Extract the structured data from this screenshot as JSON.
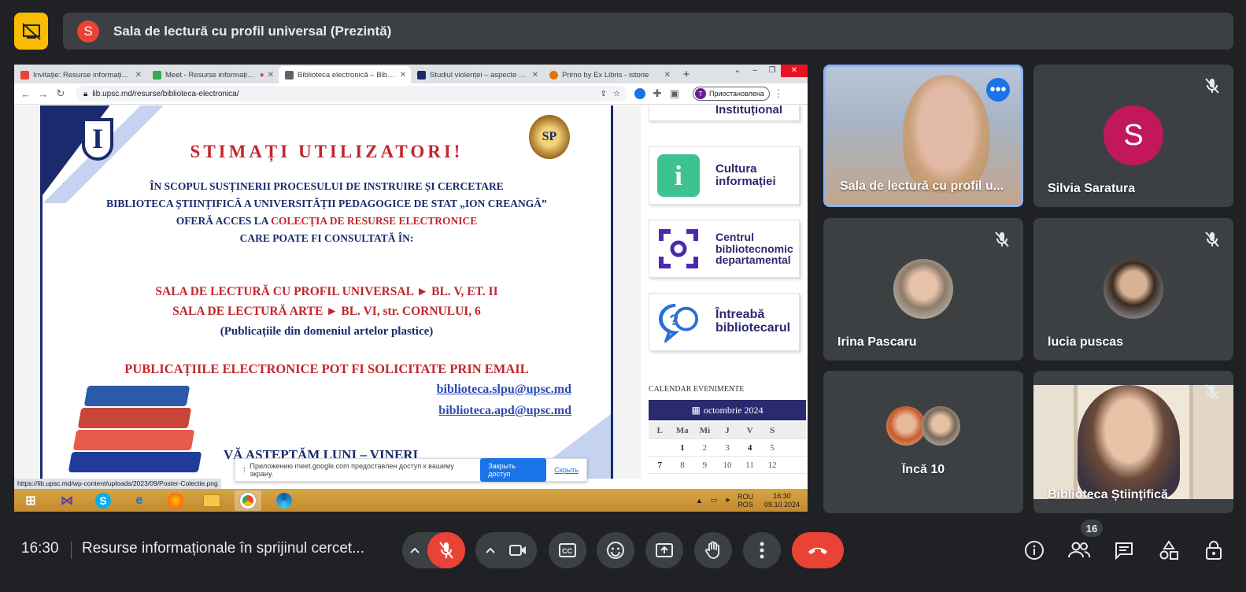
{
  "banner": {
    "presenter_initial": "S",
    "title": "Sala de lectură cu profil universal (Prezintă)"
  },
  "browser": {
    "tabs": [
      {
        "label": "Invitație: Resurse informaționale",
        "favicon_color": "#ea4335"
      },
      {
        "label": "Meet - Resurse informaționale",
        "favicon_color": "#34a853"
      },
      {
        "label": "Biblioteca electronică – Biblioteca",
        "favicon_color": "#5f6368"
      },
      {
        "label": "Studiul violenței – aspecte psihologice",
        "favicon_color": "#1a2a6c"
      },
      {
        "label": "Primo by Ex Libris - istorie",
        "favicon_color": "#e37400"
      }
    ],
    "url": "lib.upsc.md/resurse/biblioteca-electronica/",
    "profile_initial": "T",
    "profile_status": "Приостановлена",
    "status_url": "https://lib.upsc.md/wp-content/uploads/2023/09/Poster-Colectie.png"
  },
  "poster": {
    "logo_letter": "I",
    "seal_text": "SP",
    "title": "STIMAȚI UTILIZATORI!",
    "line1": "ÎN SCOPUL SUSȚINERII PROCESULUI DE INSTRUIRE ȘI CERCETARE",
    "line2": "BIBLIOTECA ȘTIINȚIFICĂ A UNIVERSITĂȚII PEDAGOGICE DE STAT „ION CREANGĂ”",
    "line3_a": "OFERĂ ACCES LA ",
    "line3_b": "COLECȚIA DE RESURSE ELECTRONICE",
    "line4": "CARE POATE FI CONSULTATĂ ÎN:",
    "loc1": "SALA DE LECTURĂ CU PROFIL UNIVERSAL ► BL. V, ET. II",
    "loc2": "SALA DE LECTURĂ ARTE ► BL. VI, str. CORNULUI, 6",
    "loc2_note": "(Publicațiile din domeniul artelor plastice)",
    "email_note": "PUBLICAȚIILE ELECTRONICE POT FI SOLICITATE PRIN EMAIL",
    "email1": "biblioteca.slpu@upsc.md",
    "email2": "biblioteca.apd@upsc.md",
    "bottom": "VĂ AȘTEPTĂM LUNI – VINERI"
  },
  "sidebar": {
    "top_card": "Instituțional",
    "cards": [
      {
        "line1": "Cultura",
        "line2": "informației"
      },
      {
        "line1": "Centrul",
        "line2": "bibliotecnomic",
        "line3": "departamental"
      },
      {
        "line1": "Întreabă",
        "line2": "bibliotecarul"
      }
    ],
    "calendar_title": "CALENDAR EVENIMENTE",
    "calendar_month": "octombrie 2024",
    "weekdays": [
      "L",
      "Ma",
      "Mi",
      "J",
      "V",
      "S"
    ],
    "days_row1": [
      "",
      "1",
      "2",
      "3",
      "4",
      "5"
    ],
    "days_row2": [
      "7",
      "8",
      "9",
      "10",
      "11",
      "12"
    ]
  },
  "share_bar": {
    "text": "Приложению meet.google.com предоставлен доступ к вашему экрану.",
    "stop_label": "Закрыть доступ",
    "hide_label": "Скрыть"
  },
  "taskbar": {
    "lang_top": "ROU",
    "lang_bottom": "ROS",
    "time": "16:30",
    "date": "09.10.2024"
  },
  "participants": [
    {
      "name": "Sala de lectură cu profil universal",
      "name_display": "Sala de lectură cu profil u..."
    },
    {
      "name": "Silvia Saratura",
      "initial": "S",
      "avatar_color": "#c2185b"
    },
    {
      "name": "Irina Pascaru"
    },
    {
      "name": "lucia puscas"
    },
    {
      "name": "Încă 10"
    },
    {
      "name": "Biblioteca Științifică"
    }
  ],
  "bottom_bar": {
    "time": "16:30",
    "meeting_title": "Resurse informaționale în sprijinul cercet...",
    "people_count": "16"
  }
}
